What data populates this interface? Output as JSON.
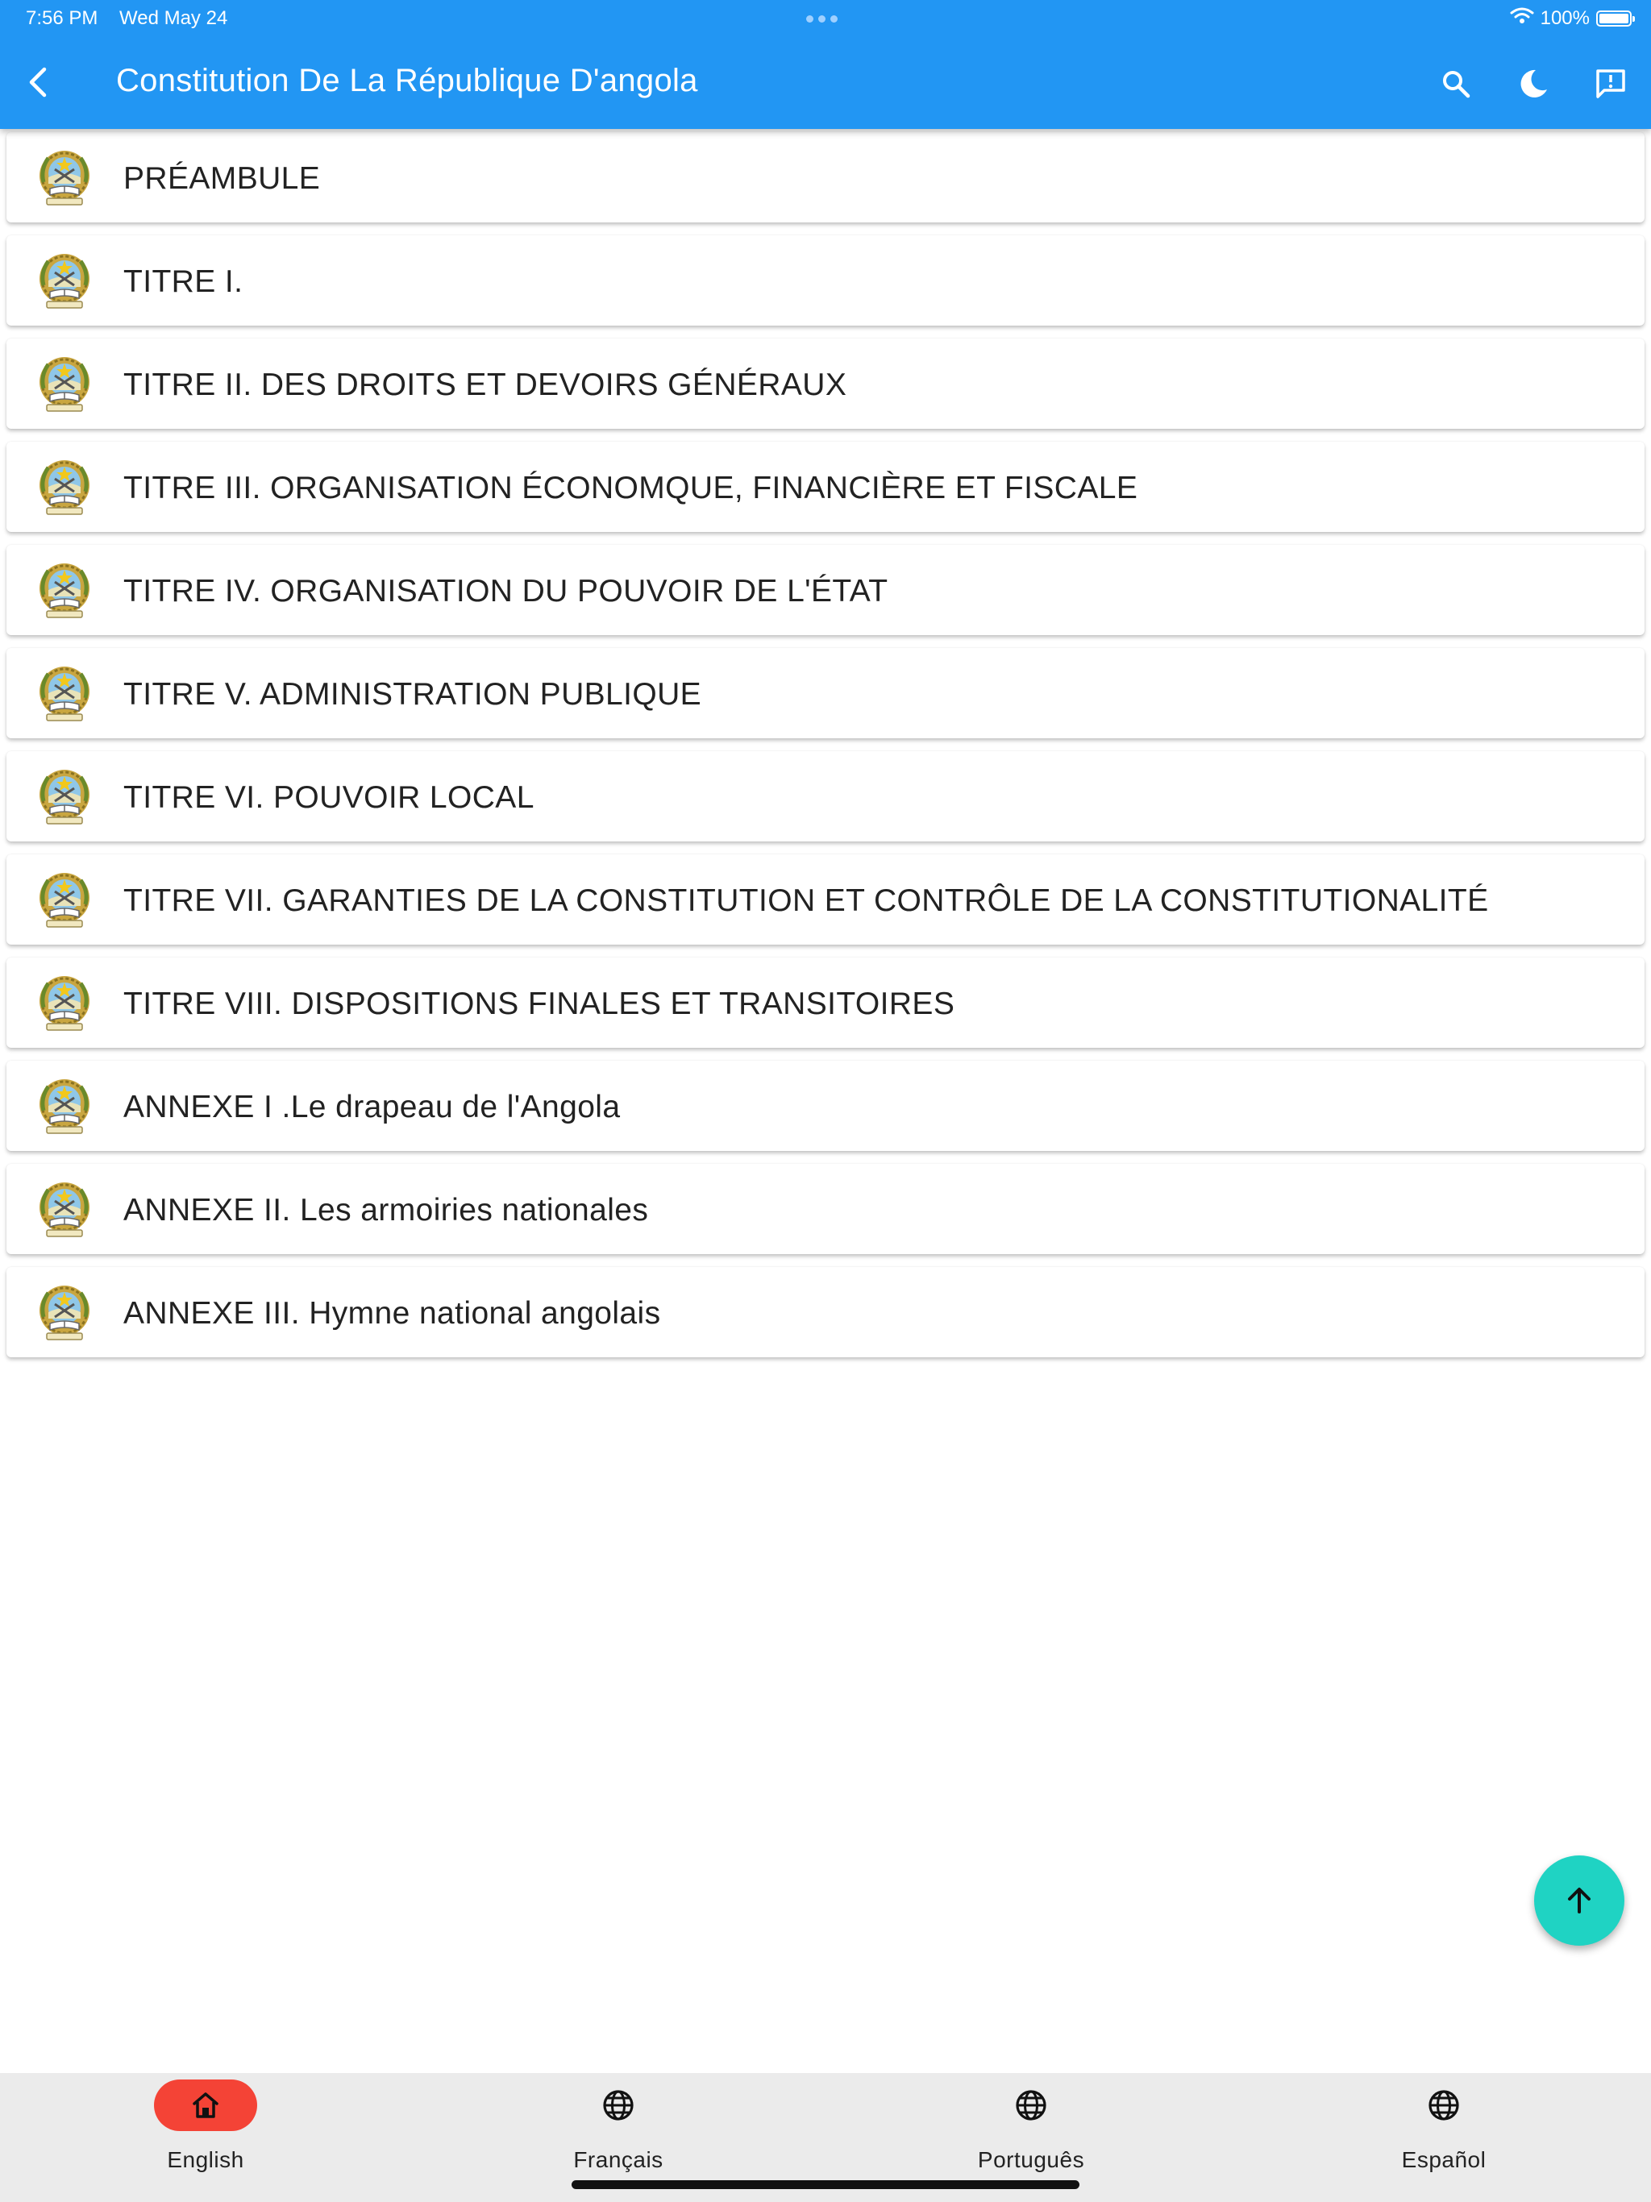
{
  "status_bar": {
    "time": "7:56 PM",
    "date": "Wed May 24",
    "battery": "100%"
  },
  "app_bar": {
    "title": "Constitution De La République D'angola",
    "icons": [
      "back-arrow-icon",
      "search-icon",
      "dark-mode-moon-icon",
      "feedback-icon"
    ]
  },
  "list": {
    "items": [
      {
        "label": "PRÉAMBULE"
      },
      {
        "label": "TITRE I."
      },
      {
        "label": "TITRE II. DES DROITS ET DEVOIRS GÉNÉRAUX"
      },
      {
        "label": "TITRE III. ORGANISATION ÉCONOMQUE, FINANCIÈRE ET FISCALE"
      },
      {
        "label": "TITRE IV. ORGANISATION DU POUVOIR DE L'ÉTAT"
      },
      {
        "label": "TITRE V. ADMINISTRATION PUBLIQUE"
      },
      {
        "label": "TITRE VI. POUVOIR LOCAL"
      },
      {
        "label": "TITRE VII. GARANTIES DE LA CONSTITUTION ET CONTRÔLE DE LA CONSTITUTIONALITÉ"
      },
      {
        "label": "TITRE VIII. DISPOSITIONS FINALES ET TRANSITOIRES"
      },
      {
        "label": "ANNEXE I .Le drapeau de l'Angola"
      },
      {
        "label": "ANNEXE II. Les armoiries nationales"
      },
      {
        "label": "ANNEXE III. Hymne national angolais"
      }
    ],
    "item_icon": "angola-emblem-icon"
  },
  "fab": {
    "icon": "arrow-up-icon"
  },
  "bottom_nav": {
    "items": [
      {
        "label": "English",
        "icon": "home-icon",
        "active": true
      },
      {
        "label": "Français",
        "icon": "globe-icon",
        "active": false
      },
      {
        "label": "Português",
        "icon": "globe-icon",
        "active": false
      },
      {
        "label": "Español",
        "icon": "globe-icon",
        "active": false
      }
    ]
  },
  "colors": {
    "app_bar": "#2296F3",
    "fab": "#1FD3C3",
    "nav_active": "#F44336",
    "nav_background": "#EBEBEB"
  }
}
